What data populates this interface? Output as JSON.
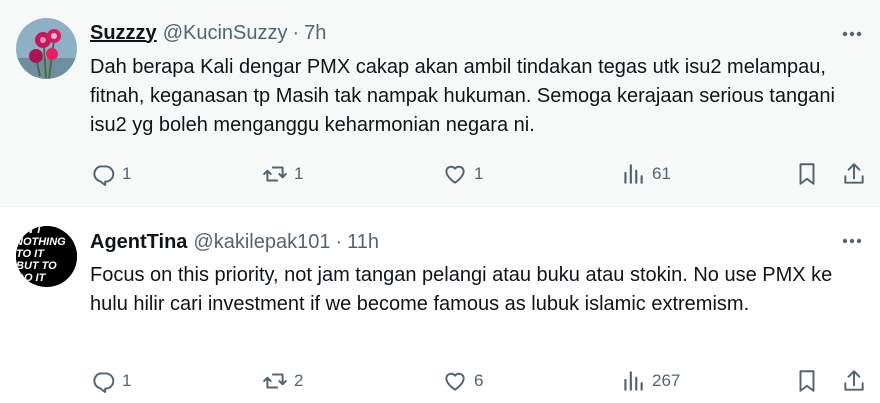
{
  "tweets": [
    {
      "name": "Suzzzy",
      "handle": "@KucinSuzzy",
      "separator": "·",
      "time": "7h",
      "text": "Dah berapa Kali dengar PMX cakap akan ambil tindakan tegas utk isu2 melampau, fitnah, keganasan tp Masih tak nampak hukuman. Semoga kerajaan serious tangani isu2 yg boleh menganggu keharmonian negara ni.",
      "replies": "1",
      "reposts": "1",
      "likes": "1",
      "views": "61",
      "avatar_icon": "pink-flowers-avatar"
    },
    {
      "name": "AgentTina",
      "handle": "@kakilepak101",
      "separator": "·",
      "time": "11h",
      "text": "Focus on this priority, not jam tangan pelangi atau buku atau stokin. No use PMX ke hulu hilir cari investment if we become famous as lubuk islamic extremism.",
      "replies": "1",
      "reposts": "2",
      "likes": "6",
      "views": "267",
      "avatar_text": [
        "AIN'T",
        "NOTHING",
        "TO IT",
        "BUT TO",
        "DO IT"
      ]
    }
  ],
  "colors": {
    "text": "#0f1419",
    "secondary": "#536471",
    "hover_bg": "#f7f9f9"
  },
  "icons": [
    "more-icon",
    "reply-icon",
    "repost-icon",
    "like-icon",
    "views-icon",
    "bookmark-icon",
    "share-icon"
  ]
}
